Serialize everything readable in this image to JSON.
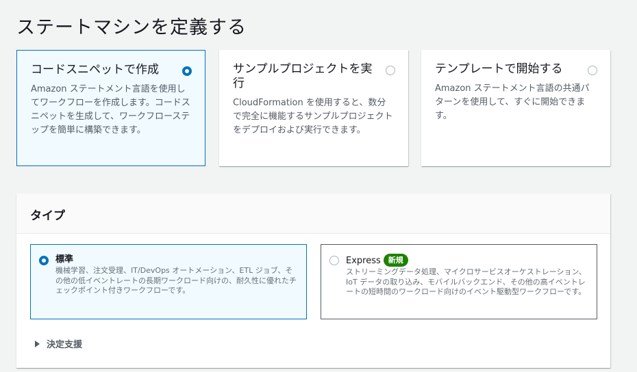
{
  "page": {
    "title": "ステートマシンを定義する"
  },
  "definition_options": [
    {
      "title": "コードスニペットで作成",
      "description": "Amazon ステートメント言語を使用してワークフローを作成します。コードスニペットを生成して、ワークフローステップを簡単に構築できます。",
      "selected": true
    },
    {
      "title": "サンプルプロジェクトを実行",
      "description": "CloudFormation を使用すると、数分で完全に機能するサンプルプロジェクトをデプロイおよび実行できます。",
      "selected": false
    },
    {
      "title": "テンプレートで開始する",
      "description": "Amazon ステートメント言語の共通パターンを使用して、すぐに開始できます。",
      "selected": false
    }
  ],
  "type_panel": {
    "title": "タイプ",
    "options": [
      {
        "label": "標準",
        "description": "機械学習、注文受理、IT/DevOps オートメーション、ETL ジョブ、その他の低イベントレートの長期ワークロード向けの、耐久性に優れたチェックポイント付きワークフローです。",
        "selected": true
      },
      {
        "label": "Express",
        "badge": "新規",
        "description": "ストリーミングデータ処理、マイクロサービスオーケストレーション、IoT データの取り込み、モバイルバックエンド、その他の高イベントレートの短時間のワークロード向けのイベント駆動型ワークフローです。",
        "selected": false
      }
    ],
    "expander_label": "決定支援"
  },
  "colors": {
    "accent": "#0073bb",
    "badge_green": "#1d8102"
  }
}
